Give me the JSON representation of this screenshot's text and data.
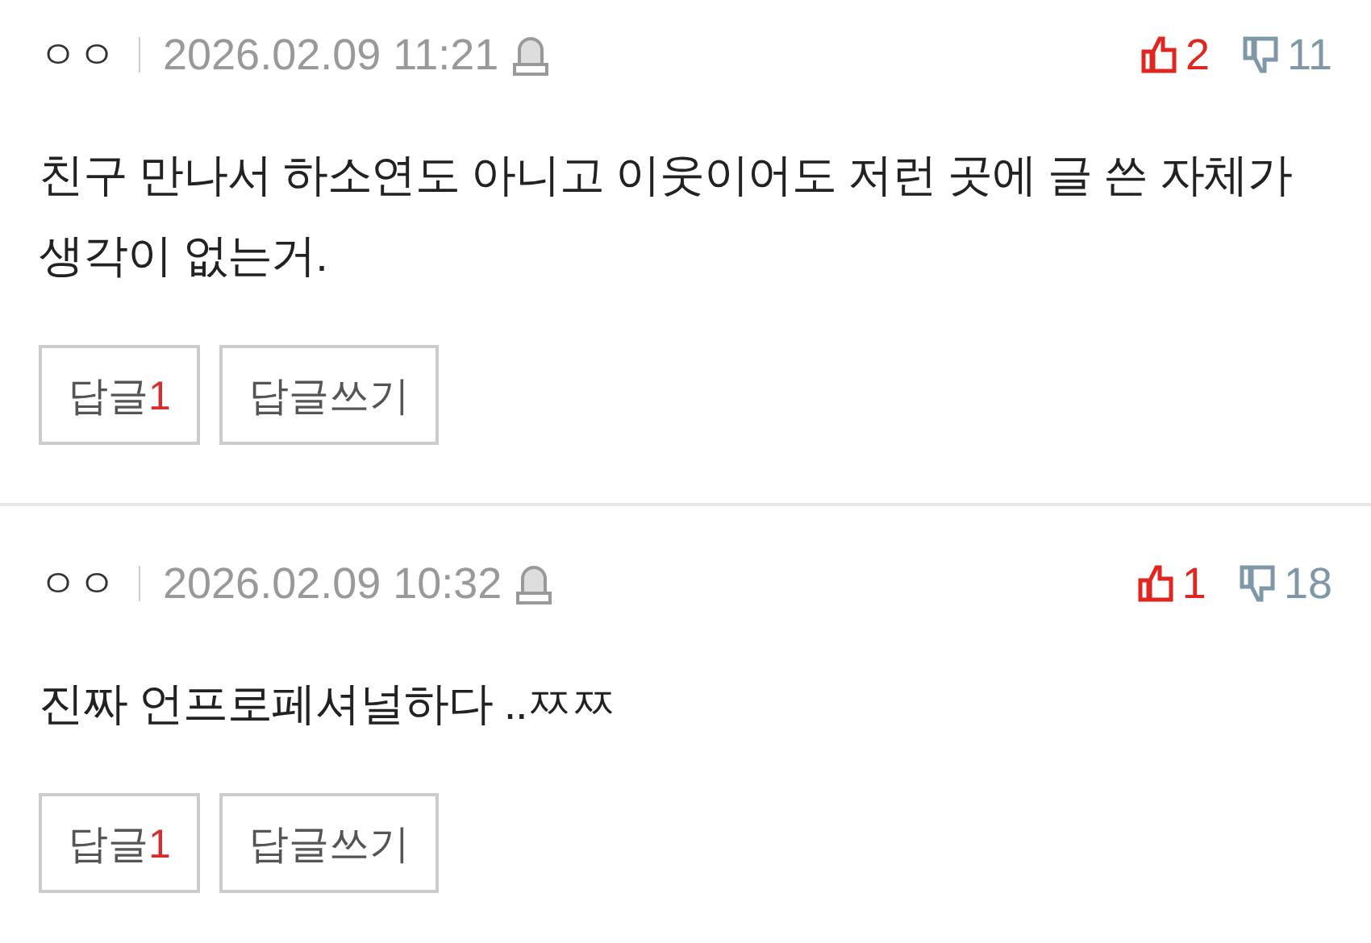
{
  "comments": [
    {
      "author": "ㅇㅇ",
      "date": "2026.02.09 11:21",
      "likes": "2",
      "dislikes": "11",
      "text": "친구 만나서 하소연도 아니고 이웃이어도 저런 곳에 글 쓴 자체가 생각이 없는거.",
      "reply_label": "답글",
      "reply_count": "1",
      "write_reply": "답글쓰기"
    },
    {
      "author": "ㅇㅇ",
      "date": "2026.02.09 10:32",
      "likes": "1",
      "dislikes": "18",
      "text": "진짜 언프로페셔널하다 ..ㅉㅉ",
      "reply_label": "답글",
      "reply_count": "1",
      "write_reply": "답글쓰기"
    }
  ]
}
